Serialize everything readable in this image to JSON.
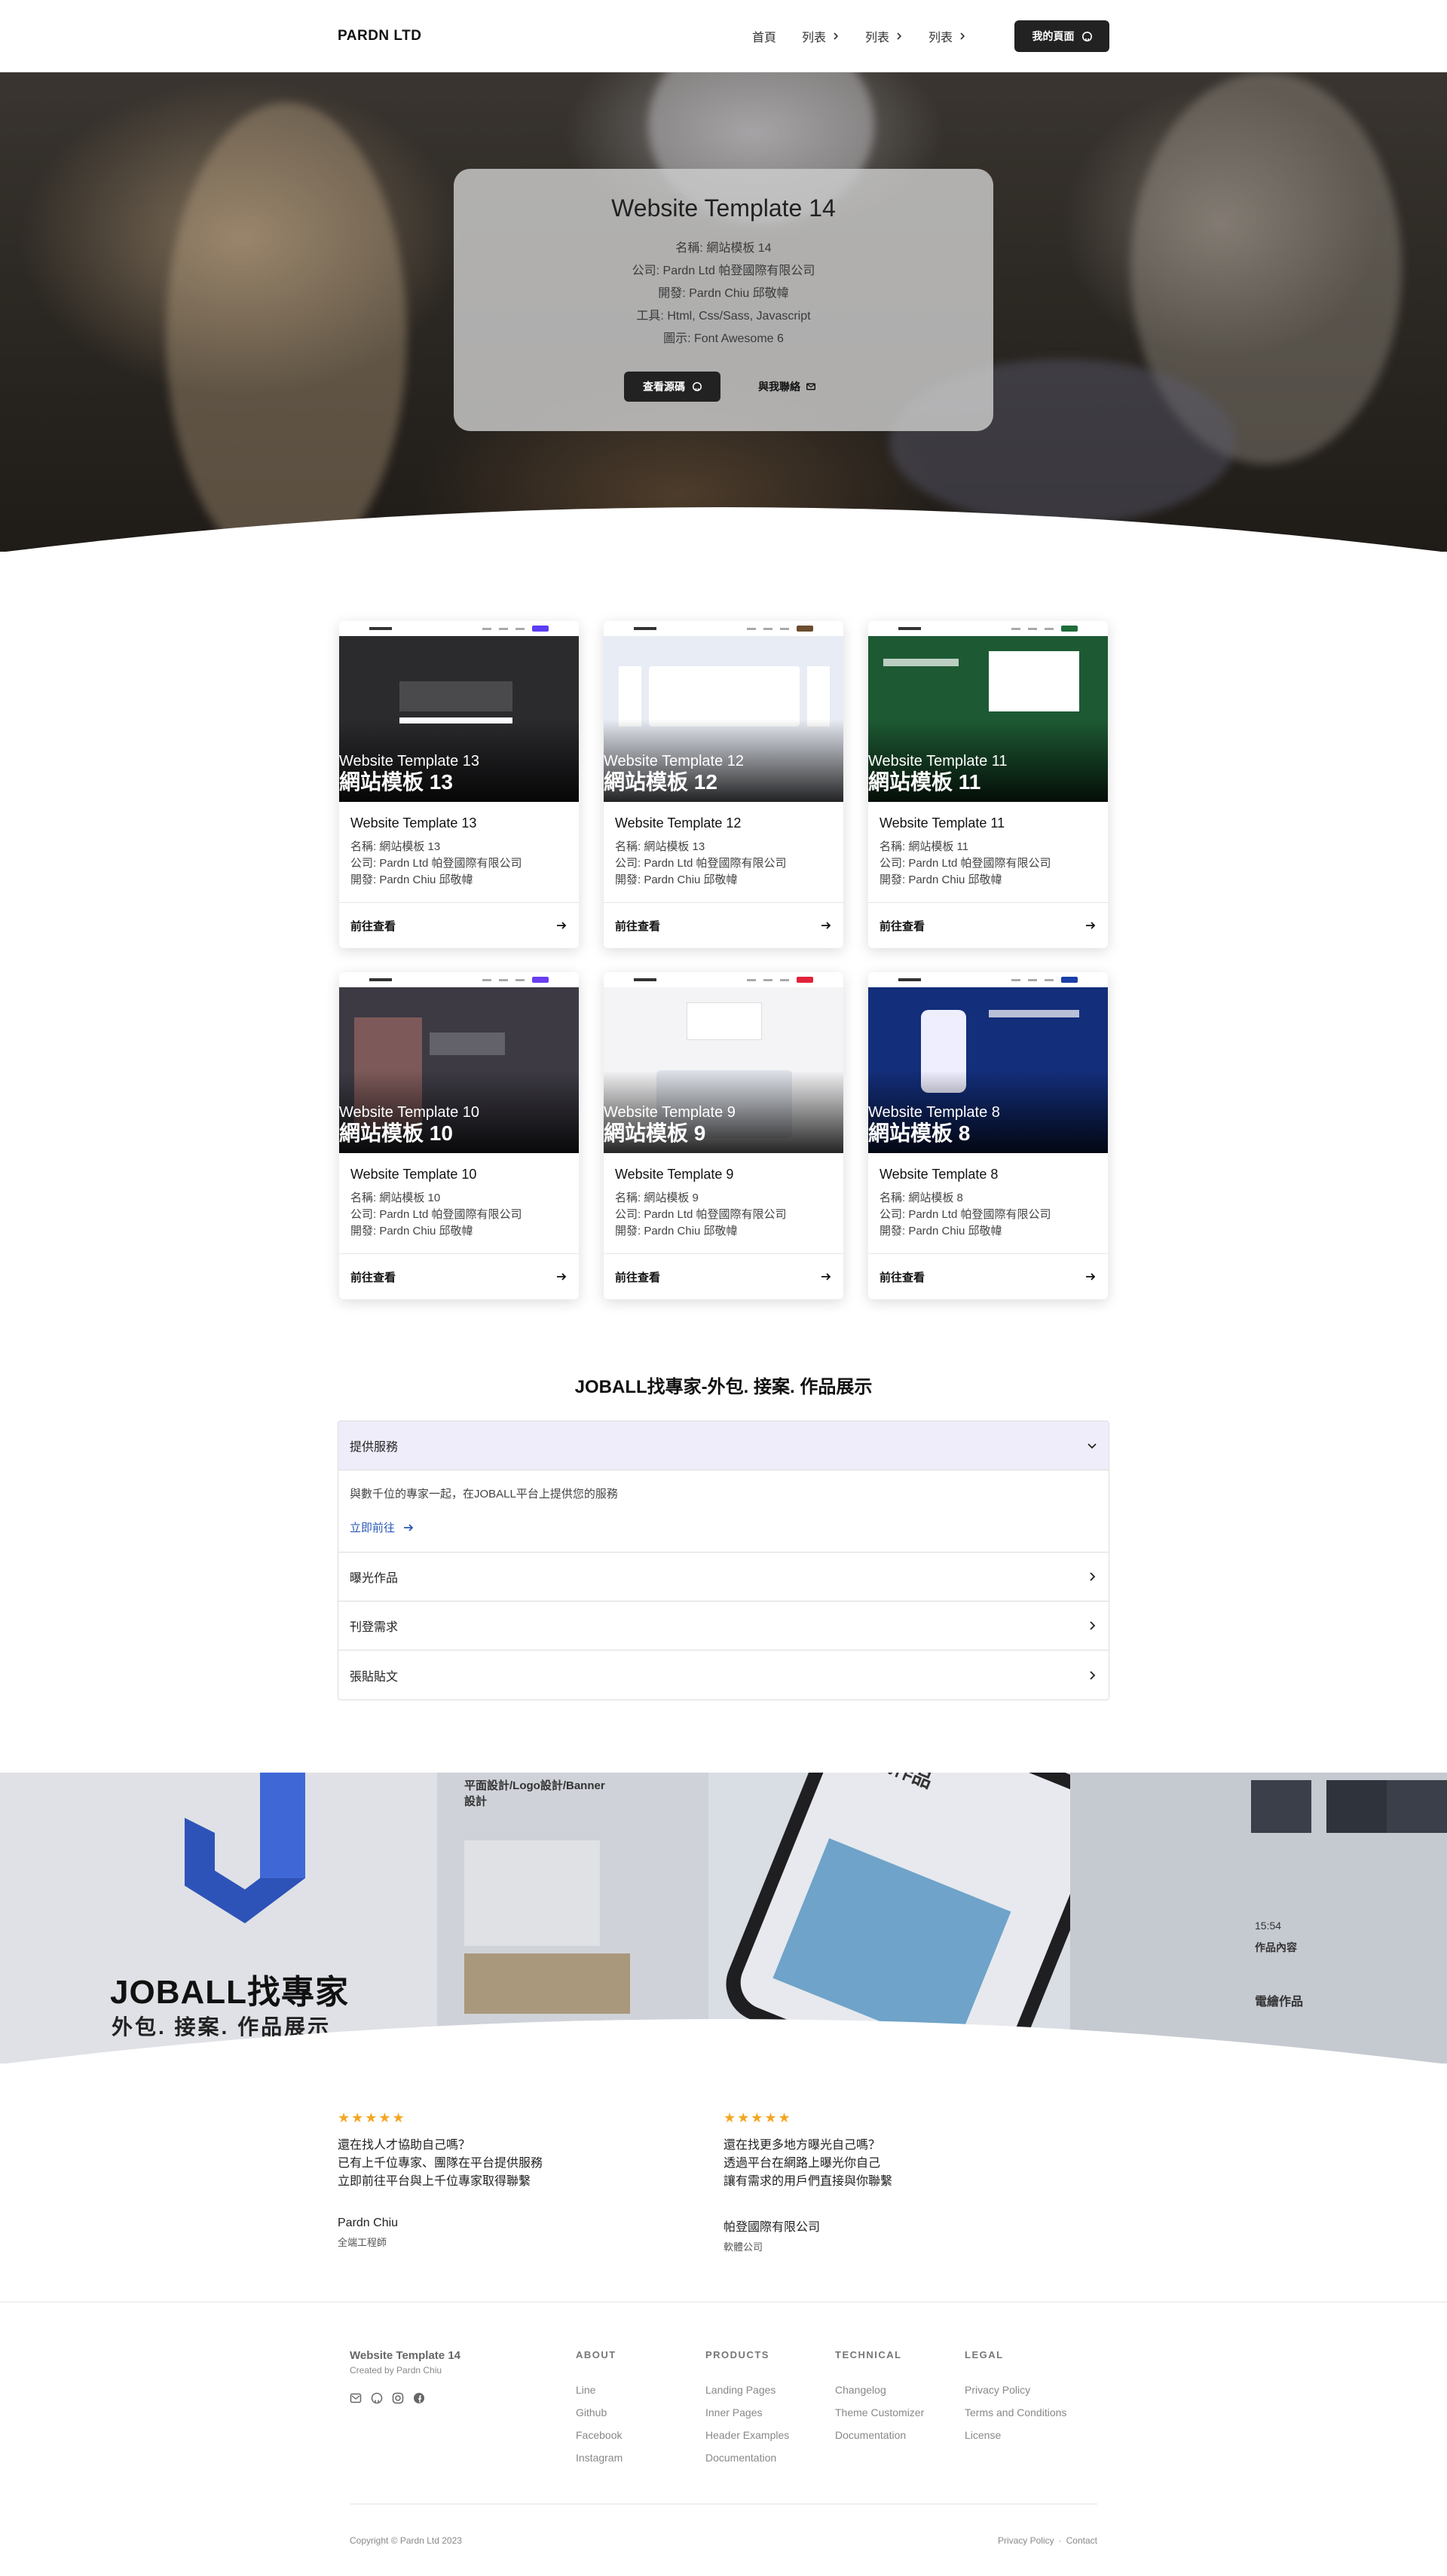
{
  "navbar": {
    "brand": "PARDN LTD",
    "links": [
      {
        "label": "首頁",
        "has_chevron": false
      },
      {
        "label": "列表",
        "has_chevron": true
      },
      {
        "label": "列表",
        "has_chevron": true
      },
      {
        "label": "列表",
        "has_chevron": true
      }
    ],
    "cta_label": "我的頁面",
    "cta_icon": "github-icon"
  },
  "hero": {
    "title": "Website Template 14",
    "info": [
      "名稱: 網站模板 14",
      "公司: Pardn Ltd 帕登國際有限公司",
      "開發: Pardn Chiu 邱敬幃",
      "工具: Html, Css/Sass, Javascript",
      "圖示: Font Awesome 6"
    ],
    "source_button": "查看源碼",
    "contact_button": "與我聯絡"
  },
  "cards": [
    {
      "thumb_en": "Website Template 13",
      "thumb_zh": "網站模板 13",
      "title": "Website Template 13",
      "name": "名稱: 網站模板 13",
      "company": "公司: Pardn Ltd 帕登國際有限公司",
      "developer": "開發: Pardn Chiu 邱敬幃",
      "link": "前往查看",
      "accent": "#5b3df5"
    },
    {
      "thumb_en": "Website Template 12",
      "thumb_zh": "網站模板 12",
      "title": "Website Template 12",
      "name": "名稱: 網站模板 13",
      "company": "公司: Pardn Ltd 帕登國際有限公司",
      "developer": "開發: Pardn Chiu 邱敬幃",
      "link": "前往查看",
      "accent": "#6b4e2e"
    },
    {
      "thumb_en": "Website Template 11",
      "thumb_zh": "網站模板 11",
      "title": "Website Template 11",
      "name": "名稱: 網站模板 11",
      "company": "公司: Pardn Ltd 帕登國際有限公司",
      "developer": "開發: Pardn Chiu 邱敬幃",
      "link": "前往查看",
      "accent": "#1f6b3a"
    },
    {
      "thumb_en": "Website Template 10",
      "thumb_zh": "網站模板 10",
      "title": "Website Template 10",
      "name": "名稱: 網站模板 10",
      "company": "公司: Pardn Ltd 帕登國際有限公司",
      "developer": "開發: Pardn Chiu 邱敬幃",
      "link": "前往查看",
      "accent": "#6a3df0"
    },
    {
      "thumb_en": "Website Template 9",
      "thumb_zh": "網站模板 9",
      "title": "Website Template 9",
      "name": "名稱: 網站模板 9",
      "company": "公司: Pardn Ltd 帕登國際有限公司",
      "developer": "開發: Pardn Chiu 邱敬幃",
      "link": "前往查看",
      "accent": "#e0223a"
    },
    {
      "thumb_en": "Website Template 8",
      "thumb_zh": "網站模板 8",
      "title": "Website Template 8",
      "name": "名稱: 網站模板 8",
      "company": "公司: Pardn Ltd 帕登國際有限公司",
      "developer": "開發: Pardn Chiu 邱敬幃",
      "link": "前往查看",
      "accent": "#1b3fa6"
    }
  ],
  "accordion": {
    "title": "JOBALL找專家-外包. 接案. 作品展示",
    "items": [
      {
        "label": "提供服務",
        "expanded": true,
        "text": "與數千位的專家一起，在JOBALL平台上提供您的服務",
        "link": "立即前往"
      },
      {
        "label": "曝光作品",
        "expanded": false
      },
      {
        "label": "刊登需求",
        "expanded": false
      },
      {
        "label": "張貼貼文",
        "expanded": false
      }
    ]
  },
  "banner": {
    "title": "JOBALL找專家",
    "subtitle": "外包. 接案. 作品展示",
    "mid_heading": "平面設計/Logo設計/Banner設計",
    "phone_heading": "找作品",
    "right_time": "15:54",
    "right_heading": "作品內容",
    "right_item": "電繪作品"
  },
  "testimonials": [
    {
      "stars": "★★★★★",
      "lines": [
        "還在找人才協助自己嗎？",
        "已有上千位專家、團隊在平台提供服務",
        "立即前往平台與上千位專家取得聯繫"
      ],
      "name": "Pardn Chiu",
      "role": "全端工程師"
    },
    {
      "stars": "★★★★★",
      "lines": [
        "還在找更多地方曝光自己嗎？",
        "透過平台在網路上曝光你自己",
        "讓有需求的用戶們直接與你聯繫"
      ],
      "name": "帕登國際有限公司",
      "role": "軟體公司"
    }
  ],
  "footer": {
    "brand_title": "Website Template 14",
    "brand_sub": "Created by Pardn Chiu",
    "social_icons": [
      "envelope-icon",
      "github-icon",
      "instagram-icon",
      "facebook-icon"
    ],
    "columns": [
      {
        "head": "ABOUT",
        "links": [
          "Line",
          "Github",
          "Facebook",
          "Instagram"
        ]
      },
      {
        "head": "PRODUCTS",
        "links": [
          "Landing Pages",
          "Inner Pages",
          "Header Examples",
          "Documentation"
        ]
      },
      {
        "head": "TECHNICAL",
        "links": [
          "Changelog",
          "Theme Customizer",
          "Documentation"
        ]
      },
      {
        "head": "LEGAL",
        "links": [
          "Privacy Policy",
          "Terms and Conditions",
          "License"
        ]
      }
    ],
    "copyright": "Copyright © Pardn Ltd 2023",
    "bottom_links": [
      "Privacy Policy",
      "·",
      "Contact"
    ]
  }
}
